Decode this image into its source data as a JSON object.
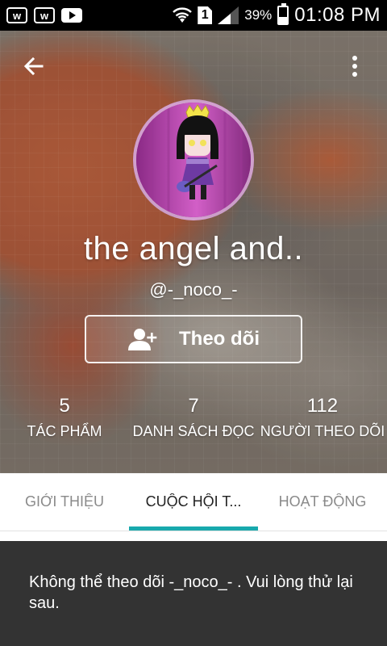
{
  "status_bar": {
    "left_icons": [
      {
        "name": "app-w-icon",
        "text": "w"
      },
      {
        "name": "app-w-icon",
        "text": "w"
      },
      {
        "name": "youtube-icon"
      }
    ],
    "sim_label": "1",
    "battery_percent": "39%",
    "time": "01:08 PM"
  },
  "header": {
    "back_icon": "arrow-left-icon",
    "more_icon": "more-vertical-icon",
    "display_name": "the angel and..",
    "username": "@-_noco_-",
    "follow_button": {
      "label": "Theo dõi",
      "icon": "add-person-icon"
    }
  },
  "stats": [
    {
      "value": "5",
      "label": "TÁC PHẨM"
    },
    {
      "value": "7",
      "label": "DANH SÁCH ĐỌC"
    },
    {
      "value": "112",
      "label": "NGƯỜI THEO DÕI"
    }
  ],
  "tabs": [
    {
      "label": "GIỚI THIỆU",
      "active": false
    },
    {
      "label": "CUỘC HỘI T...",
      "active": true
    },
    {
      "label": "HOẠT ĐỘNG",
      "active": false
    }
  ],
  "snackbar": {
    "message": "Không thể theo dõi -_noco_- . Vui lòng thử lại sau."
  },
  "colors": {
    "tab_indicator": "#18a9ad",
    "snackbar_bg": "#333333",
    "status_bar_bg": "#000000"
  }
}
